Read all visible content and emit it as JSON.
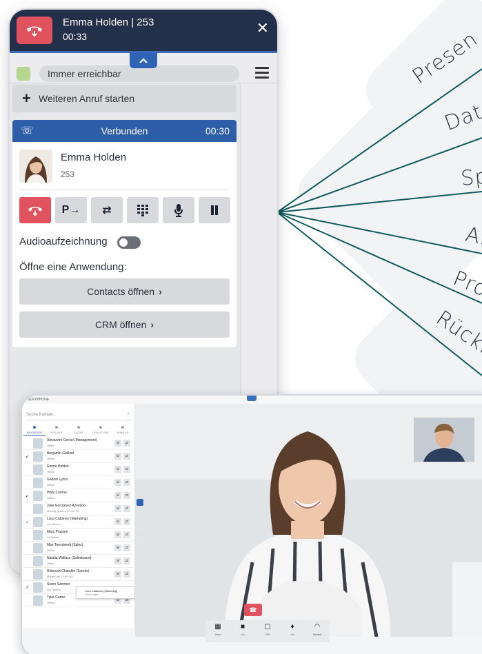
{
  "colors": {
    "header_bg": "#24304a",
    "accent_blue": "#2f5ea8",
    "hangup_red": "#e0535e",
    "line_teal": "#0f5a5c",
    "status_green": "#b7d692"
  },
  "features": [
    "Presen",
    "Dat",
    "Sp",
    "An",
    "Pro",
    "Rückr"
  ],
  "softphone": {
    "header": {
      "caller": "Emma Holden | 253",
      "time": "00:33",
      "hangup_icon": "hangup-icon",
      "close_icon": "close-icon"
    },
    "status": {
      "presence": "Immer erreichbar",
      "menu_icon": "hamburger-menu-icon",
      "collapse_icon": "chevron-up-icon"
    },
    "new_call_label": "Weiteren Anruf starten",
    "call": {
      "status": "Verbunden",
      "duration": "00:30",
      "contact_name": "Emma Holden",
      "contact_ext": "253",
      "actions": [
        "hangup-icon",
        "park-icon",
        "transfer-icon",
        "keypad-icon",
        "microphone-icon",
        "pause-icon"
      ],
      "recording_label": "Audioaufzeichnung",
      "recording_on": false,
      "open_app_label": "Öffne eine Anwendung:",
      "app_buttons": [
        "Contacts öffnen",
        "CRM öffnen"
      ]
    }
  },
  "tablet": {
    "title": "SOFTPHONE",
    "search_placeholder": "Suche Kontakt...",
    "tabs": [
      "FAVORITEN",
      "VERLAUF",
      "SUCHE",
      "UMLEITUNG",
      "WÄHLEN"
    ],
    "contacts": [
      {
        "name": "Alexandre Grevel (Management)",
        "status": "Offline"
      },
      {
        "name": "Benjamin Gaillard",
        "status": "Offline"
      },
      {
        "name": "Emma Holden",
        "status": "Offline"
      },
      {
        "name": "Gabriel Lyons",
        "status": "Offline"
      },
      {
        "name": "Holly Conroe",
        "status": "Offline"
      },
      {
        "name": "Julie Gonzalvez Azevedo",
        "status": "Montag gestern 09:00 PM"
      },
      {
        "name": "Luca Cattaneo (Marketing)",
        "status": "Am Telefon"
      },
      {
        "name": "Marc Poulsen",
        "status": "Verfügbar"
      },
      {
        "name": "Max Twerdstedt (Sales)",
        "status": "Offline"
      },
      {
        "name": "Natalia Wallace (Salesboard)",
        "status": "Offline"
      },
      {
        "name": "Rebecca Chandler (Events)",
        "status": "Morgen ab 13:00 Uhr"
      },
      {
        "name": "Soren Sammer",
        "status": "Am Telefon"
      },
      {
        "name": "Tyler Carter",
        "status": "Offline"
      }
    ],
    "popup": {
      "name": "Luca Cattaneo (Marketing)",
      "status": "Verbunden"
    },
    "video_controls": [
      {
        "icon": "grid-icon",
        "label": "View"
      },
      {
        "icon": "camera-icon",
        "label": "On"
      },
      {
        "icon": "screen-share-off-icon",
        "label": "Off"
      },
      {
        "icon": "microphone-icon",
        "label": "On"
      },
      {
        "icon": "headset-icon",
        "label": "Default"
      }
    ]
  }
}
